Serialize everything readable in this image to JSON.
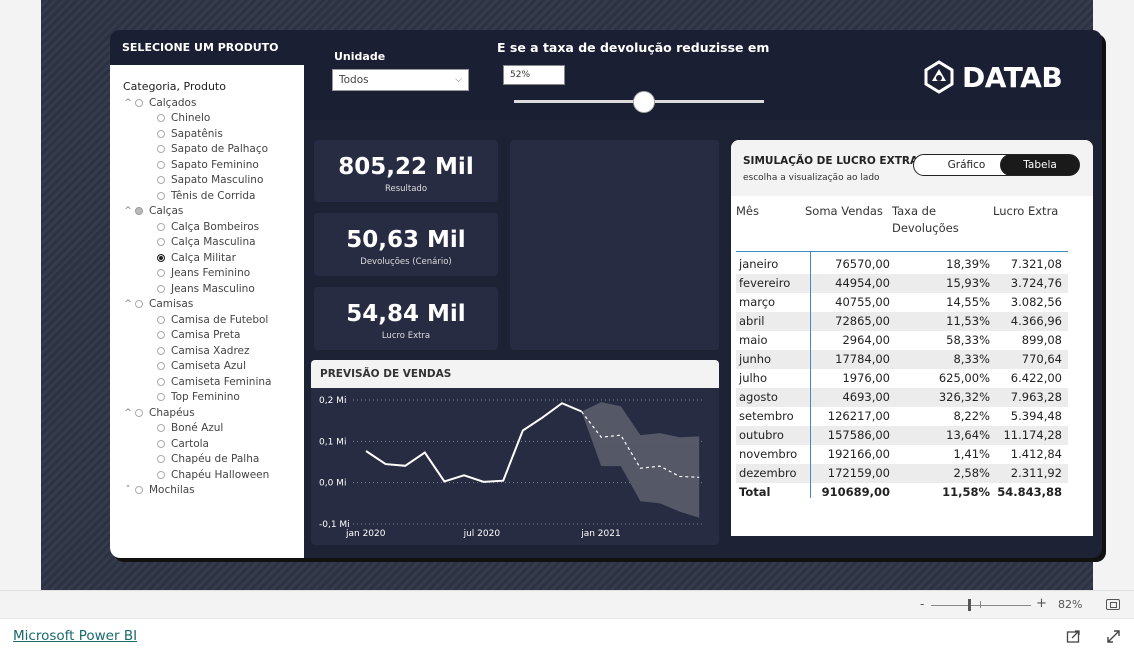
{
  "header": {
    "select_title": "SELECIONE UM PRODUTO",
    "unit_label": "Unidade",
    "unit_value": "Todos",
    "whatif_title": "E se a taxa de devolução reduzisse em",
    "whatif_value": "52%",
    "whatif_level_percent": 52,
    "logo_text": "DATAB"
  },
  "slicer": {
    "heading": "Categoria, Produto",
    "tree": [
      {
        "label": "Calçados",
        "level": 0,
        "state": "empty",
        "expanded": true
      },
      {
        "label": "Chinelo",
        "level": 1,
        "state": "empty"
      },
      {
        "label": "Sapatênis",
        "level": 1,
        "state": "empty"
      },
      {
        "label": "Sapato de Palhaço",
        "level": 1,
        "state": "empty"
      },
      {
        "label": "Sapato Feminino",
        "level": 1,
        "state": "empty"
      },
      {
        "label": "Sapato Masculino",
        "level": 1,
        "state": "empty"
      },
      {
        "label": "Tênis de Corrida",
        "level": 1,
        "state": "empty"
      },
      {
        "label": "Calças",
        "level": 0,
        "state": "partial",
        "expanded": true
      },
      {
        "label": "Calça Bombeiros",
        "level": 1,
        "state": "empty"
      },
      {
        "label": "Calça Masculina",
        "level": 1,
        "state": "empty"
      },
      {
        "label": "Calça Militar",
        "level": 1,
        "state": "filled"
      },
      {
        "label": "Jeans Feminino",
        "level": 1,
        "state": "empty"
      },
      {
        "label": "Jeans Masculino",
        "level": 1,
        "state": "empty"
      },
      {
        "label": "Camisas",
        "level": 0,
        "state": "empty",
        "expanded": true
      },
      {
        "label": "Camisa de Futebol",
        "level": 1,
        "state": "empty"
      },
      {
        "label": "Camisa Preta",
        "level": 1,
        "state": "empty"
      },
      {
        "label": "Camisa Xadrez",
        "level": 1,
        "state": "empty"
      },
      {
        "label": "Camiseta Azul",
        "level": 1,
        "state": "empty"
      },
      {
        "label": "Camiseta Feminina",
        "level": 1,
        "state": "empty"
      },
      {
        "label": "Top Feminino",
        "level": 1,
        "state": "empty"
      },
      {
        "label": "Chapéus",
        "level": 0,
        "state": "empty",
        "expanded": true
      },
      {
        "label": "Boné Azul",
        "level": 1,
        "state": "empty"
      },
      {
        "label": "Cartola",
        "level": 1,
        "state": "empty"
      },
      {
        "label": "Chapéu de Palha",
        "level": 1,
        "state": "empty"
      },
      {
        "label": "Chapéu Halloween",
        "level": 1,
        "state": "empty"
      },
      {
        "label": "Mochilas",
        "level": 0,
        "state": "empty",
        "expanded": false
      }
    ]
  },
  "kpis": [
    {
      "value": "805,22 Mil",
      "label": "Resultado"
    },
    {
      "value": "50,63 Mil",
      "label": "Devoluções (Cenário)"
    },
    {
      "value": "54,84 Mil",
      "label": "Lucro Extra"
    }
  ],
  "forecast": {
    "title": "PREVISÃO DE VENDAS"
  },
  "chart_data": {
    "type": "line",
    "title": "PREVISÃO DE VENDAS",
    "y_ticks": [
      "0,2 Mi",
      "0,1 Mi",
      "0,0 Mi",
      "-0,1 Mi"
    ],
    "y_tick_values": [
      0.2,
      0.1,
      0.0,
      -0.1
    ],
    "x_ticks": [
      "jan 2020",
      "jul 2020",
      "jan 2021"
    ],
    "ylim": [
      -0.1,
      0.2
    ],
    "grid": true,
    "series": [
      {
        "x": [
          "2020-01",
          "2020-02",
          "2020-03",
          "2020-04",
          "2020-05",
          "2020-06",
          "2020-07",
          "2020-08",
          "2020-09",
          "2020-10",
          "2020-11",
          "2020-12"
        ],
        "values": [
          0.0766,
          0.045,
          0.0408,
          0.0729,
          0.003,
          0.0178,
          0.002,
          0.0047,
          0.1262,
          0.1576,
          0.1922,
          0.1722
        ]
      },
      {
        "x": [
          "2020-12",
          "2021-01",
          "2021-02",
          "2021-03",
          "2021-04",
          "2021-05",
          "2021-06"
        ],
        "values": [
          0.172,
          0.11,
          0.115,
          0.035,
          0.04,
          0.015,
          0.013
        ],
        "style": "forecast"
      }
    ],
    "band": {
      "x": [
        "2020-12",
        "2021-01",
        "2021-02",
        "2021-03",
        "2021-04",
        "2021-05",
        "2021-06"
      ],
      "upper": [
        0.172,
        0.195,
        0.185,
        0.115,
        0.12,
        0.11,
        0.112
      ],
      "lower": [
        0.172,
        0.04,
        0.04,
        -0.045,
        -0.05,
        -0.07,
        -0.085
      ]
    },
    "colors": {
      "actual": "#ffffff",
      "forecast": "#ffffff",
      "band": "#5a5d6b"
    }
  },
  "table": {
    "title": "SIMULAÇÃO DE LUCRO EXTRA",
    "subtitle": "escolha a visualização ao lado",
    "toggle_chart": "Gráfico",
    "toggle_table": "Tabela",
    "headers": [
      "Mês",
      "Soma Vendas",
      "Taxa de Devoluções",
      "Lucro Extra"
    ],
    "rows": [
      [
        "janeiro",
        "76570,00",
        "18,39%",
        "7.321,08"
      ],
      [
        "fevereiro",
        "44954,00",
        "15,93%",
        "3.724,76"
      ],
      [
        "março",
        "40755,00",
        "14,55%",
        "3.082,56"
      ],
      [
        "abril",
        "72865,00",
        "11,53%",
        "4.366,96"
      ],
      [
        "maio",
        "2964,00",
        "58,33%",
        "899,08"
      ],
      [
        "junho",
        "17784,00",
        "8,33%",
        "770,64"
      ],
      [
        "julho",
        "1976,00",
        "625,00%",
        "6.422,00"
      ],
      [
        "agosto",
        "4693,00",
        "326,32%",
        "7.963,28"
      ],
      [
        "setembro",
        "126217,00",
        "8,22%",
        "5.394,48"
      ],
      [
        "outubro",
        "157586,00",
        "13,64%",
        "11.174,28"
      ],
      [
        "novembro",
        "192166,00",
        "1,41%",
        "1.412,84"
      ],
      [
        "dezembro",
        "172159,00",
        "2,58%",
        "2.311,92"
      ]
    ],
    "total": [
      "Total",
      "910689,00",
      "11,58%",
      "54.843,88"
    ]
  },
  "statusbar": {
    "zoom_minus": "-",
    "zoom_plus": "+",
    "zoom_value": "82%"
  },
  "footer": {
    "link": "Microsoft Power BI"
  }
}
